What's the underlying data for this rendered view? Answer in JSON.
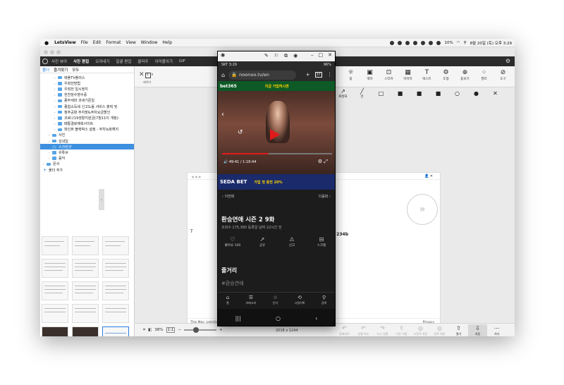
{
  "menubar": {
    "app": "LetsView",
    "items": [
      "File",
      "Edit",
      "Format",
      "View",
      "Window",
      "Help"
    ],
    "battery": "10%",
    "datetime": "8월 20일 (토) 오후 3:29"
  },
  "toolbar": {
    "items": [
      "사진 뷰어",
      "사진 편집",
      "오려내기",
      "일괄 편집",
      "콜라주",
      "이미붙이기",
      "GIF"
    ]
  },
  "sidebar": {
    "tabs": [
      "폴더",
      "즐겨찾기",
      "모두"
    ],
    "tree": [
      {
        "label": "애플TV플러스",
        "depth": 2
      },
      {
        "label": "우회전방법",
        "depth": 2
      },
      {
        "label": "우회전 일시정지",
        "depth": 2
      },
      {
        "label": "헌천징수영수증",
        "depth": 2
      },
      {
        "label": "종부세와 과세기준일",
        "depth": 2
      },
      {
        "label": "종합소득세 신고도움 서비스 출력 및",
        "depth": 2
      },
      {
        "label": "청주공항 주차장&주차요금할인",
        "depth": 2
      },
      {
        "label": "코로나19생활지원금(7월11이 개정)-",
        "depth": 2
      },
      {
        "label": "때통결로예측사이트",
        "depth": 2
      },
      {
        "label": "파인뷰 블랙박스 설정 - 주차녹화해지",
        "depth": 2
      },
      {
        "label": "사진",
        "depth": 1
      },
      {
        "label": "성내일",
        "depth": 1
      },
      {
        "label": "스크린샷",
        "depth": 1,
        "selected": true
      },
      {
        "label": "유튜브",
        "depth": 1
      },
      {
        "label": "음악",
        "depth": 1
      },
      {
        "label": "문서",
        "depth": 0
      },
      {
        "label": "폴더 추가",
        "depth": 0,
        "add": true
      }
    ]
  },
  "editor": {
    "copy_label": "레이어",
    "tools": [
      {
        "icon": "sun-icon",
        "glyph": "☼",
        "label": "빛"
      },
      {
        "icon": "border-icon",
        "glyph": "▣",
        "label": "액자"
      },
      {
        "icon": "sticker-icon",
        "glyph": "⊡",
        "label": "스티커"
      },
      {
        "icon": "image-icon",
        "glyph": "▦",
        "label": "이미지"
      },
      {
        "icon": "text-icon",
        "glyph": "T",
        "label": "텍스트"
      },
      {
        "icon": "shape-icon",
        "glyph": "⚙",
        "label": "도형"
      },
      {
        "icon": "magnifier-icon",
        "glyph": "⊕",
        "label": "돋보기"
      },
      {
        "icon": "filter-icon",
        "glyph": "⁘",
        "label": "필터"
      },
      {
        "icon": "tools-icon",
        "glyph": "⊘",
        "label": "도구"
      }
    ],
    "arrow_label": "화살표",
    "line_label": "선",
    "canvas": {
      "left_text": "T",
      "right_text": "234b",
      "footer_left": "This Mac:   LetsView(Kim's MacBook Air)",
      "footer_right": "Privacy"
    }
  },
  "bottombar": {
    "zoom": "38%",
    "fit": "1:1",
    "dimensions": "2018 x 1244",
    "actions": [
      {
        "glyph": "↶",
        "label": "원래대로",
        "state": "off"
      },
      {
        "glyph": "↶",
        "label": "실행 취소",
        "state": "off"
      },
      {
        "glyph": "↷",
        "label": "다시 실행",
        "state": "off"
      },
      {
        "glyph": "⇪",
        "label": "다른 이름",
        "state": "off"
      },
      {
        "glyph": "◎",
        "label": "오른쪽 회전",
        "state": "off"
      },
      {
        "glyph": "◎",
        "label": "왼쪽 회전",
        "state": "off"
      },
      {
        "glyph": "⇧",
        "label": "열기",
        "state": "on"
      },
      {
        "glyph": "⇩",
        "label": "저장",
        "state": "sel"
      },
      {
        "glyph": "⋯",
        "label": "기타",
        "state": "on"
      }
    ]
  },
  "phone": {
    "status_left": "SKT 3:29",
    "status_right": "96%",
    "url": "noonoo.tv/en",
    "tab_count": "37",
    "ad_top": "bet365",
    "ad_top_sub": "지금 가입하시면",
    "video_time": "49:41 / 1:18:44",
    "ad_bottom": "SEDA BET",
    "ad_bottom_sub": "가입 첫 충전 20%",
    "prev": "이전화",
    "next": "다음화",
    "title": "환승연애 시즌 2 9화",
    "meta": "조회수 175,380   등록일 날짜 22시간 전",
    "actions": [
      {
        "glyph": "♡",
        "label": "좋아요 100"
      },
      {
        "glyph": "↗",
        "label": "공유"
      },
      {
        "glyph": "⚠",
        "label": "신고"
      },
      {
        "glyph": "⊟",
        "label": "스크랩"
      }
    ],
    "section": "줄거리",
    "hashtag": "#환승연애",
    "nav": [
      {
        "glyph": "⌂",
        "label": "홈"
      },
      {
        "glyph": "☰",
        "label": "카테고리"
      },
      {
        "glyph": "☆",
        "label": "인기"
      },
      {
        "glyph": "⟲",
        "label": "시청기록"
      },
      {
        "glyph": "⚲",
        "label": "검색"
      }
    ]
  }
}
